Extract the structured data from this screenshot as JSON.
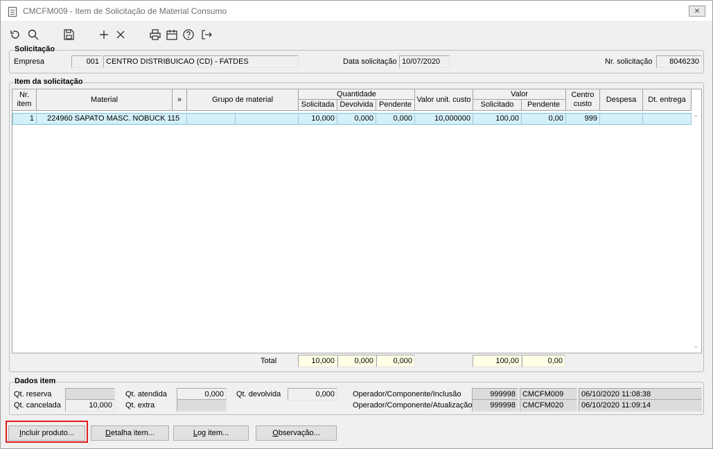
{
  "window": {
    "title": "CMCFM009 - Item de Solicitação de Material Consumo",
    "close_label": "⨯"
  },
  "toolbar": {
    "icons": [
      "undo-icon",
      "search-icon",
      "save-icon",
      "add-icon",
      "delete-icon",
      "print-icon",
      "calendar-icon",
      "help-icon",
      "exit-icon"
    ]
  },
  "solicitacao": {
    "legend": "Solicitação",
    "empresa_label": "Empresa",
    "empresa_code": "001",
    "empresa_name": "CENTRO DISTRIBUICAO (CD) - FATDES",
    "data_label": "Data solicitação",
    "data_value": "10/07/2020",
    "nr_label": "Nr. solicitação",
    "nr_value": "8046230"
  },
  "item": {
    "legend": "Item da solicitação",
    "headers": {
      "nr_item": "Nr. item",
      "material": "Material",
      "expand": "»",
      "grupo": "Grupo de material",
      "quantidade": "Quantidade",
      "solicitada": "Solicitada",
      "devolvida": "Devolvida",
      "pendente": "Pendente",
      "valor_unit": "Valor unit. custo",
      "valor": "Valor",
      "v_solicitado": "Solicitado",
      "v_pendente": "Pendente",
      "centro": "Centro custo",
      "despesa": "Despesa",
      "dt_entrega": "Dt. entrega"
    },
    "rows": [
      {
        "nr": "1",
        "material": "224960 SAPATO MASC. NOBUCK 115",
        "grupo": "",
        "solicitada": "10,000",
        "devolvida": "0,000",
        "pendente": "0,000",
        "valor_unit": "10,000000",
        "v_solicitado": "100,00",
        "v_pendente": "0,00",
        "centro": "999",
        "despesa": "",
        "dt_entrega": ""
      }
    ],
    "total_label": "Total",
    "total_solicitada": "10,000",
    "total_devolvida": "0,000",
    "total_pendente": "0,000",
    "total_v_solicitado": "100,00",
    "total_v_pendente": "0,00"
  },
  "dados": {
    "legend": "Dados item",
    "qt_reserva_label": "Qt. reserva",
    "qt_reserva": "",
    "qt_cancelada_label": "Qt. cancelada",
    "qt_cancelada": "10,000",
    "qt_atendida_label": "Qt. atendida",
    "qt_atendida": "0,000",
    "qt_extra_label": "Qt. extra",
    "qt_extra": "",
    "qt_devolvida_label": "Qt. devolvida",
    "qt_devolvida": "0,000",
    "op_inclusao_label": "Operador/Componente/Inclusão",
    "op_inclusao_code": "999998",
    "op_inclusao_comp": "CMCFM009",
    "op_inclusao_date": "06/10/2020 11:08:38",
    "op_atualizacao_label": "Operador/Componente/Atualização",
    "op_atualizacao_code": "999998",
    "op_atualizacao_comp": "CMCFM020",
    "op_atualizacao_date": "06/10/2020 11:09:14"
  },
  "buttons": {
    "incluir_first": "I",
    "incluir_rest": "ncluir produto...",
    "detalha_first": "D",
    "detalha_rest": "etalha item...",
    "log_first": "L",
    "log_rest": "og item...",
    "obs_first": "O",
    "obs_rest": "bservação..."
  }
}
